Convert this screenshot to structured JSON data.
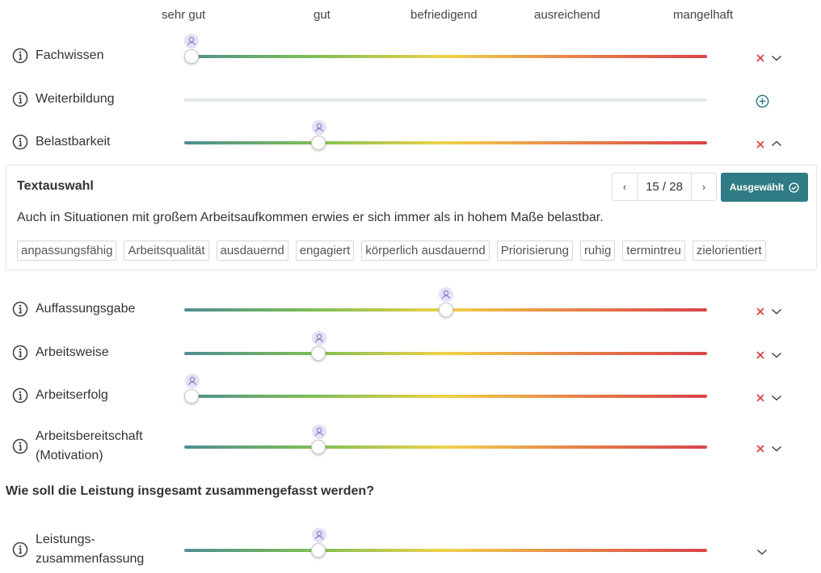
{
  "scale": [
    "sehr gut",
    "gut",
    "befriedigend",
    "ausreichend",
    "mangelhaft"
  ],
  "rows": [
    {
      "label": "Fachwissen",
      "value": 1.0,
      "state": "collapsed"
    },
    {
      "label": "Weiterbildung",
      "value": null,
      "state": "empty"
    },
    {
      "label": "Belastbarkeit",
      "value": 2.0,
      "state": "expanded"
    },
    {
      "label": "Auffassungsgabe",
      "value": 3.0,
      "state": "collapsed"
    },
    {
      "label": "Arbeitsweise",
      "value": 2.0,
      "state": "collapsed"
    },
    {
      "label": "Arbeitserfolg",
      "value": 1.0,
      "state": "collapsed"
    },
    {
      "label": "Arbeitsbereitschaft (Motivation)",
      "label_lines": [
        "Arbeitsbereitschaft",
        "(Motivation)"
      ],
      "value": 2.0,
      "state": "collapsed"
    }
  ],
  "panel": {
    "title": "Textauswahl",
    "pager": {
      "prev": "‹",
      "current": "15 / 28",
      "next": "›"
    },
    "selected_label": "Ausgewählt",
    "text": "Auch in Situationen mit großem Arbeitsaufkommen erwies er sich immer als in hohem Maße belastbar.",
    "chips": [
      "anpassungsfähig",
      "Arbeitsqualität",
      "ausdauernd",
      "engagiert",
      "körperlich ausdauernd",
      "Priorisierung",
      "ruhig",
      "termintreu",
      "zielorientiert"
    ]
  },
  "summary_question": "Wie soll die Leistung insgesamt zusammengefasst werden?",
  "summary_row": {
    "label_lines": [
      "Leistungs-",
      "zusammenfassung"
    ],
    "value": 2.0
  },
  "colors": {
    "accent": "#2f7c84",
    "remove": "#d9434a",
    "avatar_bg": "#e7e1f7",
    "avatar_fg": "#8a7fc0",
    "icon": "#444444"
  }
}
